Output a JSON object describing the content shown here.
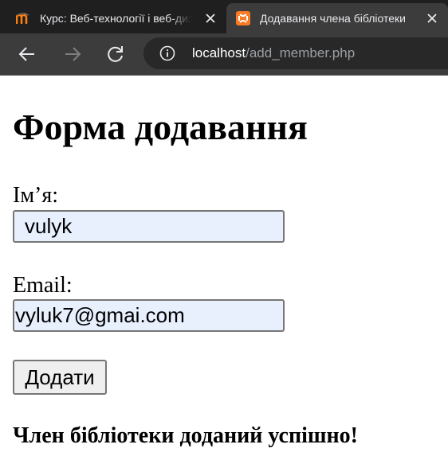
{
  "browser": {
    "tabs": [
      {
        "title": "Курс: Веб-технології і веб-дизайн",
        "icon": "moodle-icon",
        "active": false
      },
      {
        "title": "Додавання члена бібліотеки",
        "icon": "xampp-icon",
        "active": true
      }
    ],
    "address": {
      "host": "localhost",
      "path": "/add_member.php"
    }
  },
  "page": {
    "title": "Форма додавання",
    "form": {
      "name_label": "Ім’я:",
      "name_value": "vulyk",
      "email_label": "Email:",
      "email_value": "vyluk7@gmai.com",
      "submit_label": "Додати"
    },
    "message": "Член бібліотеки доданий успішно!"
  },
  "colors": {
    "autofill_background": "#e8f0fe",
    "tabbar_background": "#1f1f1f",
    "toolbar_background": "#3c3c3c"
  }
}
